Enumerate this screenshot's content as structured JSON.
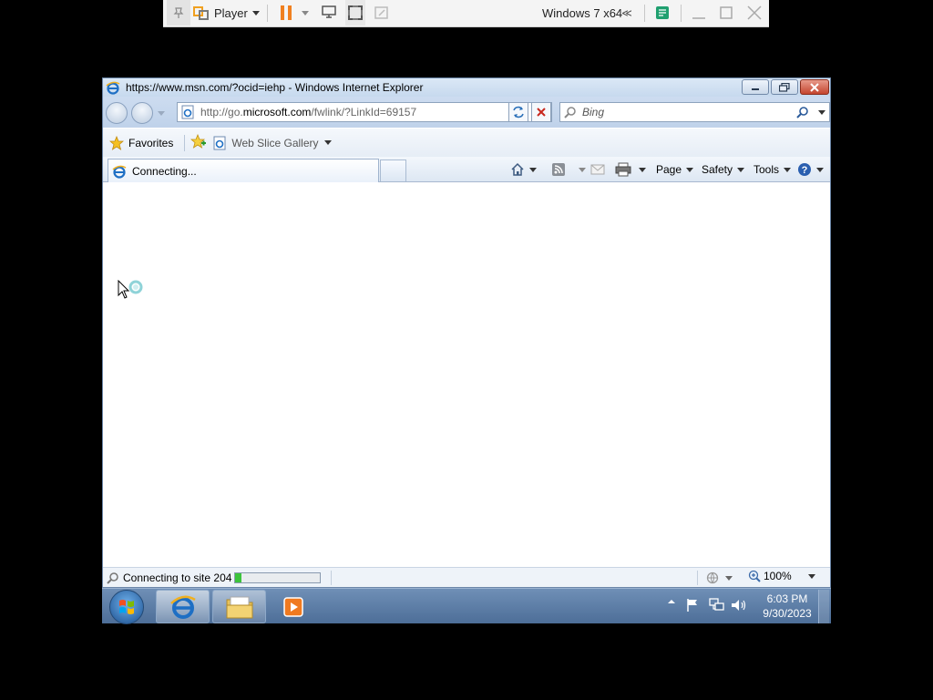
{
  "vm_toolbar": {
    "player_label": "Player",
    "vm_name": "Windows 7 x64",
    "back_symbol": "≪"
  },
  "ie": {
    "window_title": "https://www.msn.com/?ocid=iehp - Windows Internet Explorer",
    "address": {
      "url_prefix": "http://go.",
      "url_domain": "microsoft.com",
      "url_path": "/fwlink/?LinkId=69157"
    },
    "search": {
      "placeholder": "Bing"
    },
    "favorites": {
      "favorites_label": "Favorites",
      "web_slice_label": "Web Slice Gallery"
    },
    "tab": {
      "label": "Connecting..."
    },
    "commands": {
      "page_label": "Page",
      "safety_label": "Safety",
      "tools_label": "Tools"
    },
    "status": {
      "text": "Connecting to site 204",
      "progress_fraction": 0.08,
      "zoom": "100%"
    }
  },
  "taskbar": {
    "time": "6:03 PM",
    "date": "9/30/2023"
  },
  "colors": {
    "ie_blue": "#1e6fc4",
    "progress_green": "#3cc43c",
    "close_red": "#c4452f",
    "taskbar": "#5a7aa3"
  }
}
